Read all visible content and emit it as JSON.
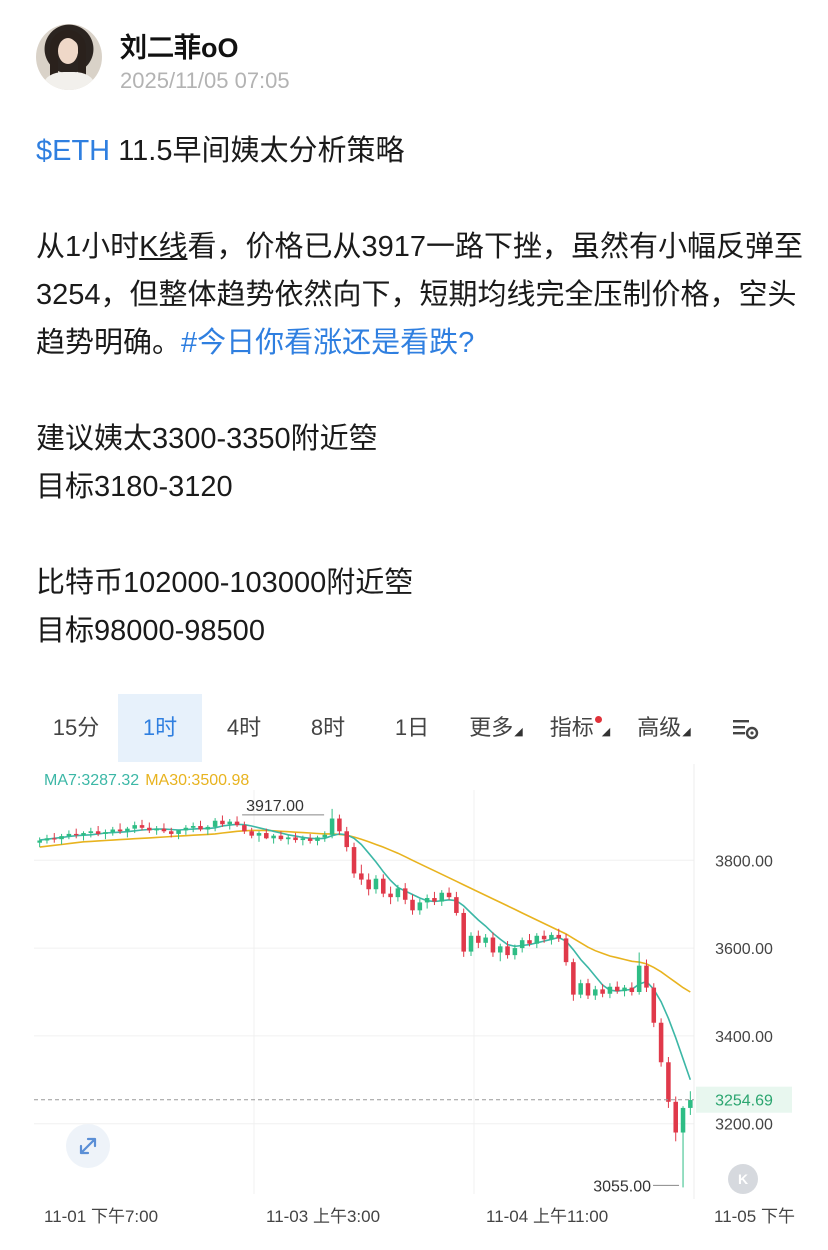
{
  "post": {
    "author": "刘二菲oO",
    "timestamp": "2025/11/05 07:05",
    "title_tag": "$ETH",
    "title_text": " 11.5早间姨太分析策略",
    "para1_a": "从1小时",
    "para1_k": "K线",
    "para1_b": "看，价格已从3917一路下挫，虽然有小幅反弹至3254，但整体趋势依然向下，短期均线完全压制价格，空头趋势明确。",
    "para1_tag": "#今日你看涨还是看跌?",
    "eth_entry": "建议姨太3300-3350附近箜",
    "eth_target": "目标3180-3120",
    "btc_entry": "比特币102000-103000附近箜",
    "btc_target": "目标98000-98500"
  },
  "tabs": [
    "15分",
    "1时",
    "4时",
    "8时",
    "1日",
    "更多",
    "指标",
    "高级"
  ],
  "active_tab": "1时",
  "icons": {
    "settings": "settings-icon",
    "expand": "expand-icon",
    "kline": "kline-icon"
  },
  "ma_legend": {
    "ma7": "MA7:3287.32",
    "ma30": "MA30:3500.98"
  },
  "colors": {
    "up": "#2ebd85",
    "down": "#e0394a",
    "ma7": "#3cb7a6",
    "ma30": "#e8b31f",
    "link": "#2f7fe0"
  },
  "chart_data": {
    "type": "candlestick",
    "ylim": [
      3040,
      3960
    ],
    "y_ticks": [
      "3800.00",
      "3600.00",
      "3400.00",
      "3200.00"
    ],
    "x_ticks": [
      "11-01 下午7:00",
      "11-03 上午3:00",
      "11-04 上午11:00",
      "11-05 下午"
    ],
    "current_price": "3254.69",
    "high_label": "3917.00",
    "low_label": "3055.00",
    "high_value": 3917,
    "low_value": 3055,
    "ohlc": [
      [
        3840,
        3852,
        3830,
        3845
      ],
      [
        3845,
        3858,
        3838,
        3850
      ],
      [
        3850,
        3862,
        3840,
        3848
      ],
      [
        3848,
        3860,
        3836,
        3855
      ],
      [
        3855,
        3868,
        3848,
        3860
      ],
      [
        3860,
        3872,
        3850,
        3857
      ],
      [
        3857,
        3866,
        3845,
        3862
      ],
      [
        3862,
        3874,
        3852,
        3866
      ],
      [
        3866,
        3878,
        3855,
        3860
      ],
      [
        3860,
        3870,
        3848,
        3864
      ],
      [
        3864,
        3876,
        3856,
        3870
      ],
      [
        3870,
        3884,
        3860,
        3866
      ],
      [
        3866,
        3876,
        3852,
        3872
      ],
      [
        3872,
        3888,
        3862,
        3880
      ],
      [
        3880,
        3892,
        3868,
        3874
      ],
      [
        3874,
        3886,
        3862,
        3868
      ],
      [
        3868,
        3878,
        3858,
        3872
      ],
      [
        3872,
        3884,
        3862,
        3866
      ],
      [
        3866,
        3874,
        3852,
        3860
      ],
      [
        3860,
        3870,
        3848,
        3868
      ],
      [
        3868,
        3880,
        3858,
        3874
      ],
      [
        3874,
        3886,
        3864,
        3878
      ],
      [
        3878,
        3890,
        3866,
        3870
      ],
      [
        3870,
        3880,
        3858,
        3876
      ],
      [
        3876,
        3896,
        3866,
        3890
      ],
      [
        3890,
        3902,
        3876,
        3882
      ],
      [
        3882,
        3894,
        3870,
        3888
      ],
      [
        3888,
        3900,
        3876,
        3880
      ],
      [
        3880,
        3888,
        3860,
        3866
      ],
      [
        3866,
        3874,
        3850,
        3856
      ],
      [
        3856,
        3866,
        3842,
        3862
      ],
      [
        3862,
        3872,
        3848,
        3850
      ],
      [
        3850,
        3860,
        3838,
        3856
      ],
      [
        3856,
        3866,
        3844,
        3848
      ],
      [
        3848,
        3858,
        3836,
        3852
      ],
      [
        3852,
        3862,
        3840,
        3846
      ],
      [
        3846,
        3856,
        3834,
        3850
      ],
      [
        3850,
        3860,
        3838,
        3844
      ],
      [
        3844,
        3856,
        3834,
        3852
      ],
      [
        3852,
        3866,
        3842,
        3858
      ],
      [
        3858,
        3917,
        3850,
        3895
      ],
      [
        3895,
        3904,
        3858,
        3866
      ],
      [
        3866,
        3876,
        3820,
        3830
      ],
      [
        3830,
        3840,
        3760,
        3770
      ],
      [
        3770,
        3790,
        3744,
        3756
      ],
      [
        3756,
        3770,
        3720,
        3734
      ],
      [
        3734,
        3766,
        3724,
        3758
      ],
      [
        3758,
        3768,
        3716,
        3724
      ],
      [
        3724,
        3740,
        3700,
        3716
      ],
      [
        3716,
        3744,
        3706,
        3736
      ],
      [
        3736,
        3748,
        3700,
        3710
      ],
      [
        3710,
        3722,
        3676,
        3686
      ],
      [
        3686,
        3712,
        3676,
        3704
      ],
      [
        3704,
        3722,
        3690,
        3714
      ],
      [
        3714,
        3728,
        3698,
        3706
      ],
      [
        3706,
        3732,
        3696,
        3726
      ],
      [
        3726,
        3738,
        3710,
        3716
      ],
      [
        3716,
        3728,
        3674,
        3680
      ],
      [
        3680,
        3690,
        3580,
        3592
      ],
      [
        3592,
        3636,
        3582,
        3628
      ],
      [
        3628,
        3640,
        3600,
        3612
      ],
      [
        3612,
        3632,
        3602,
        3624
      ],
      [
        3624,
        3636,
        3580,
        3590
      ],
      [
        3590,
        3610,
        3570,
        3604
      ],
      [
        3604,
        3616,
        3576,
        3584
      ],
      [
        3584,
        3608,
        3574,
        3600
      ],
      [
        3600,
        3624,
        3590,
        3618
      ],
      [
        3618,
        3632,
        3604,
        3610
      ],
      [
        3610,
        3634,
        3600,
        3628
      ],
      [
        3628,
        3640,
        3612,
        3620
      ],
      [
        3620,
        3636,
        3608,
        3630
      ],
      [
        3630,
        3644,
        3614,
        3622
      ],
      [
        3622,
        3632,
        3560,
        3568
      ],
      [
        3568,
        3576,
        3480,
        3494
      ],
      [
        3494,
        3528,
        3486,
        3520
      ],
      [
        3520,
        3530,
        3484,
        3492
      ],
      [
        3492,
        3514,
        3482,
        3506
      ],
      [
        3506,
        3518,
        3488,
        3496
      ],
      [
        3496,
        3520,
        3486,
        3512
      ],
      [
        3512,
        3524,
        3496,
        3502
      ],
      [
        3502,
        3516,
        3490,
        3510
      ],
      [
        3510,
        3522,
        3492,
        3500
      ],
      [
        3500,
        3590,
        3494,
        3560
      ],
      [
        3560,
        3574,
        3500,
        3510
      ],
      [
        3510,
        3520,
        3420,
        3430
      ],
      [
        3430,
        3440,
        3330,
        3340
      ],
      [
        3340,
        3352,
        3236,
        3250
      ],
      [
        3250,
        3262,
        3160,
        3180
      ],
      [
        3180,
        3240,
        3055,
        3236
      ],
      [
        3236,
        3274,
        3220,
        3254
      ]
    ],
    "ma7": [
      3846,
      3848,
      3850,
      3852,
      3854,
      3856,
      3857,
      3858,
      3860,
      3862,
      3863,
      3864,
      3865,
      3867,
      3869,
      3870,
      3871,
      3871,
      3870,
      3869,
      3870,
      3871,
      3872,
      3872,
      3874,
      3878,
      3880,
      3882,
      3881,
      3878,
      3874,
      3870,
      3866,
      3862,
      3858,
      3855,
      3852,
      3850,
      3849,
      3850,
      3856,
      3860,
      3858,
      3850,
      3836,
      3816,
      3796,
      3774,
      3754,
      3738,
      3730,
      3722,
      3714,
      3708,
      3706,
      3708,
      3710,
      3708,
      3696,
      3680,
      3664,
      3650,
      3634,
      3620,
      3608,
      3604,
      3606,
      3608,
      3612,
      3616,
      3620,
      3624,
      3616,
      3596,
      3574,
      3556,
      3536,
      3516,
      3504,
      3502,
      3504,
      3506,
      3518,
      3524,
      3506,
      3478,
      3440,
      3396,
      3348,
      3300
    ],
    "ma30": [
      3830,
      3832,
      3834,
      3836,
      3838,
      3840,
      3842,
      3843,
      3844,
      3845,
      3846,
      3847,
      3848,
      3849,
      3850,
      3851,
      3852,
      3853,
      3854,
      3855,
      3856,
      3857,
      3858,
      3859,
      3860,
      3862,
      3864,
      3866,
      3867,
      3868,
      3868,
      3868,
      3867,
      3866,
      3865,
      3864,
      3863,
      3862,
      3861,
      3860,
      3860,
      3859,
      3857,
      3853,
      3848,
      3842,
      3836,
      3830,
      3823,
      3816,
      3808,
      3800,
      3792,
      3784,
      3776,
      3768,
      3760,
      3752,
      3744,
      3736,
      3728,
      3720,
      3712,
      3704,
      3696,
      3688,
      3680,
      3672,
      3664,
      3656,
      3648,
      3640,
      3632,
      3622,
      3612,
      3602,
      3594,
      3588,
      3582,
      3578,
      3574,
      3570,
      3568,
      3564,
      3556,
      3546,
      3534,
      3522,
      3510,
      3500
    ]
  }
}
